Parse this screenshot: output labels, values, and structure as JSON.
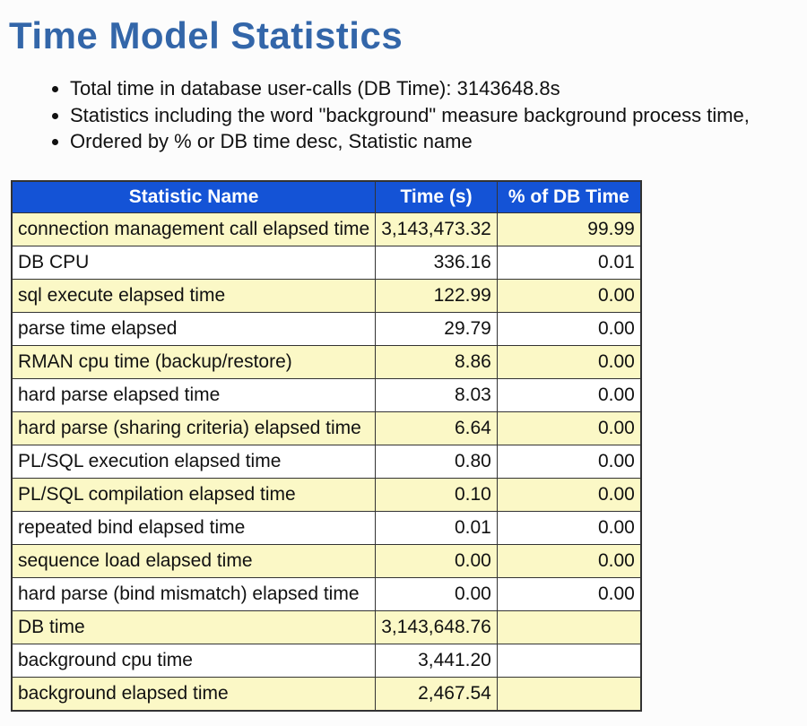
{
  "heading": "Time Model Statistics",
  "notes": [
    "Total time in database user-calls (DB Time): 3143648.8s",
    "Statistics including the word \"background\" measure background process time,",
    "Ordered by % or DB time desc, Statistic name"
  ],
  "table": {
    "headers": {
      "name": "Statistic Name",
      "time": "Time (s)",
      "pct": "% of DB Time"
    },
    "rows": [
      {
        "name": "connection management call elapsed time",
        "time": "3,143,473.32",
        "pct": "99.99"
      },
      {
        "name": "DB CPU",
        "time": "336.16",
        "pct": "0.01"
      },
      {
        "name": "sql execute elapsed time",
        "time": "122.99",
        "pct": "0.00"
      },
      {
        "name": "parse time elapsed",
        "time": "29.79",
        "pct": "0.00"
      },
      {
        "name": "RMAN cpu time (backup/restore)",
        "time": "8.86",
        "pct": "0.00"
      },
      {
        "name": "hard parse elapsed time",
        "time": "8.03",
        "pct": "0.00"
      },
      {
        "name": "hard parse (sharing criteria) elapsed time",
        "time": "6.64",
        "pct": "0.00"
      },
      {
        "name": "PL/SQL execution elapsed time",
        "time": "0.80",
        "pct": "0.00"
      },
      {
        "name": "PL/SQL compilation elapsed time",
        "time": "0.10",
        "pct": "0.00"
      },
      {
        "name": "repeated bind elapsed time",
        "time": "0.01",
        "pct": "0.00"
      },
      {
        "name": "sequence load elapsed time",
        "time": "0.00",
        "pct": "0.00"
      },
      {
        "name": "hard parse (bind mismatch) elapsed time",
        "time": "0.00",
        "pct": "0.00"
      },
      {
        "name": "DB time",
        "time": "3,143,648.76",
        "pct": ""
      },
      {
        "name": "background cpu time",
        "time": "3,441.20",
        "pct": ""
      },
      {
        "name": "background elapsed time",
        "time": "2,467.54",
        "pct": ""
      }
    ]
  }
}
